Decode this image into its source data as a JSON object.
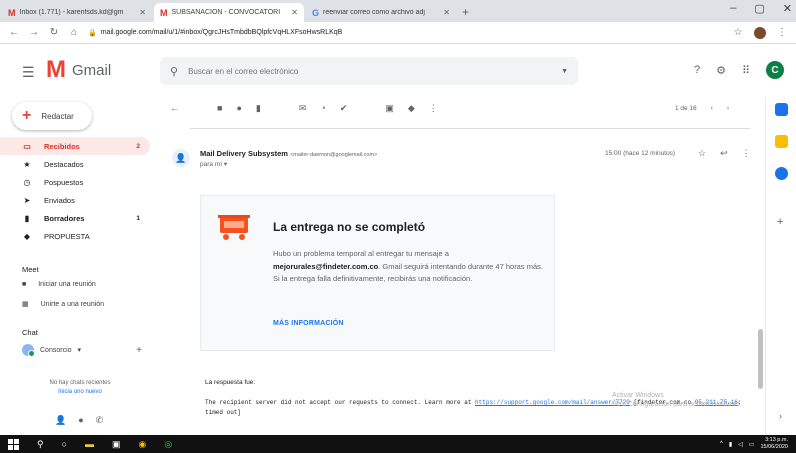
{
  "browser": {
    "tabs": [
      {
        "icon": "M",
        "title": "Inbox (1.771) - karenfsds.kd@gm",
        "active": false
      },
      {
        "icon": "M",
        "title": "SUBSANACION - CONVOCATORI",
        "active": true
      },
      {
        "icon": "G",
        "title": "reenviar correo como archivo adj",
        "active": false
      }
    ],
    "new_tab": "+",
    "url": "mail.google.com/mail/u/1/#inbox/QgrcJHsTmbdbBQlpfcVqHLXFsoHwsRLKqB"
  },
  "gmail": {
    "logo_text": "Gmail",
    "search_placeholder": "Buscar en el correo electrónico",
    "avatar_letter": "C"
  },
  "sidebar": {
    "compose": "Redactar",
    "items": [
      {
        "label": "Recibidos",
        "count": "2",
        "icon": "inbox-icon",
        "active": true,
        "bold": true
      },
      {
        "label": "Destacados",
        "count": "",
        "icon": "star-icon",
        "active": false,
        "bold": false
      },
      {
        "label": "Pospuestos",
        "count": "",
        "icon": "clock-icon",
        "active": false,
        "bold": false
      },
      {
        "label": "Enviados",
        "count": "",
        "icon": "send-icon",
        "active": false,
        "bold": false
      },
      {
        "label": "Borradores",
        "count": "1",
        "icon": "draft-icon",
        "active": false,
        "bold": true
      },
      {
        "label": "PROPUESTA",
        "count": "",
        "icon": "label-icon",
        "active": false,
        "bold": false
      }
    ],
    "meet_title": "Meet",
    "meet_items": [
      "Iniciar una reunión",
      "Unirte a una reunión"
    ],
    "chat_title": "Chat",
    "chat_user": "Consorcio",
    "no_chats": "No hay chats recientes",
    "start_new": "Inicia uno nuevo"
  },
  "toolbar": {
    "pager": "1 de 16"
  },
  "email": {
    "sender_name": "Mail Delivery Subsystem",
    "sender_addr": "<mailer-daemon@googlemail.com>",
    "to": "para mí",
    "time": "15:00 (hace 12 minutos)",
    "card": {
      "title": "La entrega no se completó",
      "body_1": "Hubo un problema temporal al entregar tu mensaje a",
      "recipient": "mejorurales@findeter.com.co",
      "body_2": ". Gmail seguirá intentando durante 47 horas más. Si la entrega falla definitivamente, recibirás una notificación.",
      "link": "MÁS INFORMACIÓN"
    },
    "response_label": "La respuesta fue:",
    "response_pre": "The recipient server did not accept our requests to connect. Learn more at ",
    "response_link": "https://support.google.com/mail/answer/7720",
    "response_mid": " [findeter.com.co",
    "response_ip": "95.211.75.16",
    "response_end": ": timed out]",
    "watermark_1": "Activar Windows",
    "watermark_2": "Ve a Configuración para activar Windows."
  },
  "taskbar": {
    "time": "3:13 p.m.",
    "date": "15/06/2020"
  }
}
